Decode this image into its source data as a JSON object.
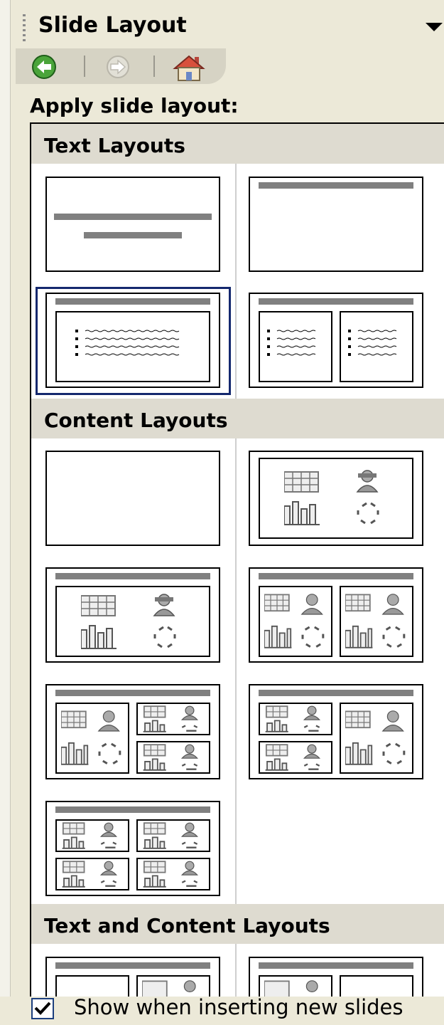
{
  "pane": {
    "title": "Slide Layout"
  },
  "nav": {
    "back": "back-icon",
    "forward": "forward-icon",
    "home": "home-icon"
  },
  "apply_label": "Apply slide layout:",
  "sections": [
    {
      "label": "Text Layouts"
    },
    {
      "label": "Content Layouts"
    },
    {
      "label": "Text and Content Layouts"
    }
  ],
  "layouts": {
    "text": [
      "Title Slide",
      "Title Only",
      "Title and Text",
      "Title and 2-Column Text"
    ],
    "content": [
      "Blank",
      "Content",
      "Title and Content",
      "Title and 2 Content",
      "Title, Content and 2 Content",
      "Title, 2 Content and Content",
      "Title and 4 Content"
    ],
    "text_and_content": [
      "Title, Text and Content",
      "Title, Content and Text"
    ]
  },
  "footer": {
    "checkbox_checked": true,
    "label": "Show when inserting new slides"
  },
  "colors": {
    "selection": "#14286e",
    "section_bg": "#dedbd0",
    "pane_bg": "#ece9d8"
  }
}
